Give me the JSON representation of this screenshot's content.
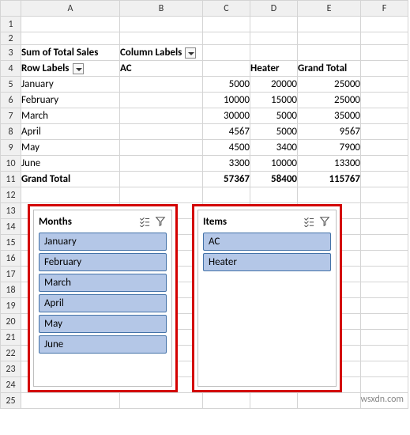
{
  "columns": [
    "A",
    "B",
    "C",
    "D",
    "E",
    "F"
  ],
  "rows": [
    "1",
    "2",
    "3",
    "4",
    "5",
    "6",
    "7",
    "8",
    "9",
    "10",
    "11",
    "12",
    "13",
    "14",
    "15",
    "16",
    "17",
    "18",
    "19",
    "20",
    "21",
    "22",
    "23",
    "24",
    "25"
  ],
  "pivot": {
    "title": "Sum of Total Sales",
    "col_label_title": "Column Labels",
    "row_label_title": "Row Labels",
    "col_headers": [
      "AC",
      "Heater",
      "Grand Total"
    ],
    "rows": [
      {
        "label": "January",
        "vals": [
          "5000",
          "20000",
          "25000"
        ]
      },
      {
        "label": "February",
        "vals": [
          "10000",
          "15000",
          "25000"
        ]
      },
      {
        "label": "March",
        "vals": [
          "30000",
          "5000",
          "35000"
        ]
      },
      {
        "label": "April",
        "vals": [
          "4567",
          "5000",
          "9567"
        ]
      },
      {
        "label": "May",
        "vals": [
          "4500",
          "3400",
          "7900"
        ]
      },
      {
        "label": "June",
        "vals": [
          "3300",
          "10000",
          "13300"
        ]
      }
    ],
    "grand_total": {
      "label": "Grand Total",
      "vals": [
        "57367",
        "58400",
        "115767"
      ]
    }
  },
  "slicers": {
    "months": {
      "title": "Months",
      "items": [
        "January",
        "February",
        "March",
        "April",
        "May",
        "June"
      ]
    },
    "items": {
      "title": "Items",
      "items": [
        "AC",
        "Heater"
      ]
    }
  },
  "watermark": "wsxdn.com"
}
